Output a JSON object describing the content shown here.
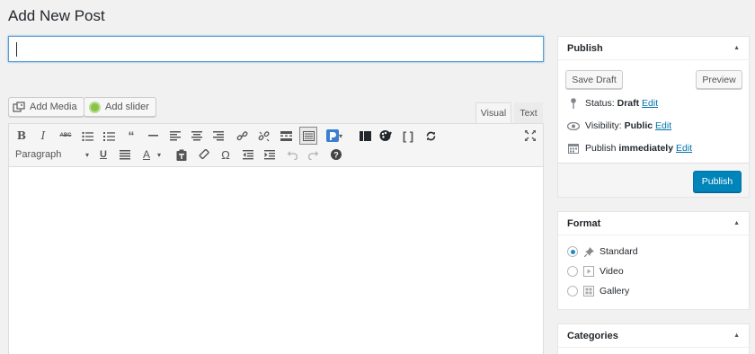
{
  "page": {
    "title": "Add New Post"
  },
  "title_input": {
    "value": ""
  },
  "media_buttons": {
    "add_media": "Add Media",
    "add_slider": "Add slider"
  },
  "editor_tabs": {
    "visual": "Visual",
    "text": "Text",
    "active": "visual"
  },
  "toolbar": {
    "row1_icons": [
      "bold-icon",
      "italic-icon",
      "strikethrough-icon",
      "bulleted-list-icon",
      "numbered-list-icon",
      "blockquote-icon",
      "horizontal-line-icon",
      "align-left-icon",
      "align-center-icon",
      "align-right-icon",
      "insert-link-icon",
      "remove-link-icon",
      "read-more-icon",
      "toolbar-toggle-icon",
      "plugin-icon",
      "plugin-dropdown-icon",
      "layout-icon",
      "palette-icon",
      "shortcode-brackets-icon",
      "refresh-icon",
      "fullscreen-icon"
    ],
    "bold_glyph": "B",
    "italic_glyph": "I",
    "strike_glyph": "ABC",
    "format_select": "Paragraph",
    "row2_icons": [
      "underline-icon",
      "justify-icon",
      "text-color-icon",
      "text-color-dropdown-icon",
      "paste-as-text-icon",
      "clear-formatting-icon",
      "special-character-icon",
      "outdent-icon",
      "indent-icon",
      "undo-icon",
      "redo-icon",
      "help-icon"
    ],
    "underline_glyph": "U",
    "text_color_glyph": "A",
    "omega_glyph": "Ω"
  },
  "publish_box": {
    "heading": "Publish",
    "save_draft": "Save Draft",
    "preview": "Preview",
    "status_label": "Status:",
    "status_value": "Draft",
    "status_edit": "Edit",
    "visibility_label": "Visibility:",
    "visibility_value": "Public",
    "visibility_edit": "Edit",
    "publish_label": "Publish",
    "publish_value": "immediately",
    "publish_edit": "Edit",
    "publish_button": "Publish"
  },
  "format_box": {
    "heading": "Format",
    "options": [
      {
        "label": "Standard",
        "checked": true
      },
      {
        "label": "Video",
        "checked": false
      },
      {
        "label": "Gallery",
        "checked": false
      }
    ]
  },
  "categories_box": {
    "heading": "Categories"
  },
  "colors": {
    "accent": "#0085ba",
    "link": "#0073aa",
    "background": "#f1f1f1"
  }
}
